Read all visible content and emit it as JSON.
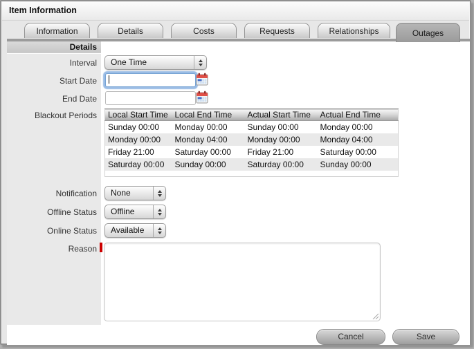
{
  "window": {
    "title": "Item Information"
  },
  "tabs": [
    {
      "label": "Information",
      "active": false
    },
    {
      "label": "Details",
      "active": false
    },
    {
      "label": "Costs",
      "active": false
    },
    {
      "label": "Requests",
      "active": false
    },
    {
      "label": "Relationships",
      "active": false
    },
    {
      "label": "Outages",
      "active": true
    }
  ],
  "form": {
    "section_header": "Details",
    "interval": {
      "label": "Interval",
      "value": "One Time"
    },
    "start_date": {
      "label": "Start Date",
      "value": ""
    },
    "end_date": {
      "label": "End Date",
      "value": ""
    },
    "blackout_periods": {
      "label": "Blackout Periods",
      "columns": [
        "Local Start Time",
        "Local End Time",
        "Actual Start Time",
        "Actual End Time"
      ],
      "rows": [
        [
          "Sunday 00:00",
          "Monday 00:00",
          "Sunday 00:00",
          "Monday 00:00"
        ],
        [
          "Monday 00:00",
          "Monday 04:00",
          "Monday 00:00",
          "Monday 04:00"
        ],
        [
          "Friday 21:00",
          "Saturday 00:00",
          "Friday 21:00",
          "Saturday 00:00"
        ],
        [
          "Saturday 00:00",
          "Sunday 00:00",
          "Saturday 00:00",
          "Sunday 00:00"
        ]
      ]
    },
    "notification": {
      "label": "Notification",
      "value": "None"
    },
    "offline_status": {
      "label": "Offline Status",
      "value": "Offline"
    },
    "online_status": {
      "label": "Online Status",
      "value": "Available"
    },
    "reason": {
      "label": "Reason",
      "required": true,
      "value": ""
    }
  },
  "buttons": {
    "cancel": "Cancel",
    "save": "Save"
  },
  "icons": {
    "calendar": "calendar-icon",
    "dropdown_arrows": "up-down-arrows-icon",
    "resize": "resize-grip-icon"
  },
  "colors": {
    "focus_ring": "#78a5dc",
    "required_marker": "#cc0000",
    "active_tab": "#9b9b9b",
    "calendar_red": "#e05048",
    "calendar_blue": "#4a72c8"
  }
}
